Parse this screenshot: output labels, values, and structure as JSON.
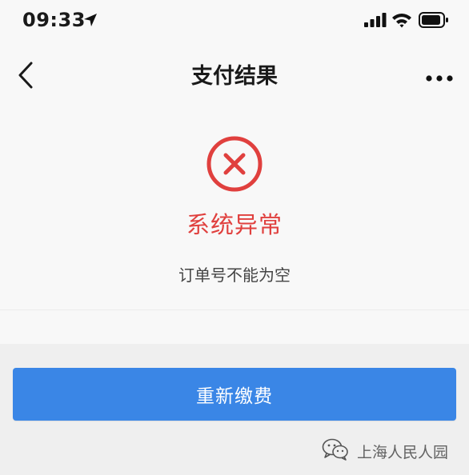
{
  "status_bar": {
    "time": "09:33",
    "icons": [
      "location-arrow-icon",
      "cellular-signal-icon",
      "wifi-icon",
      "battery-icon"
    ]
  },
  "nav": {
    "title": "支付结果",
    "back_icon": "chevron-left-icon",
    "more_icon": "more-dots-icon"
  },
  "result": {
    "status_icon": "error-circle-icon",
    "title": "系统异常",
    "message": "订单号不能为空"
  },
  "actions": {
    "repay_label": "重新缴费"
  },
  "watermark": {
    "icon": "wechat-icon",
    "text": "上海人民人园"
  },
  "colors": {
    "accent": "#3a86e6",
    "error": "#e0403e",
    "background": "#f8f8f8",
    "footer_background": "#efefef"
  }
}
